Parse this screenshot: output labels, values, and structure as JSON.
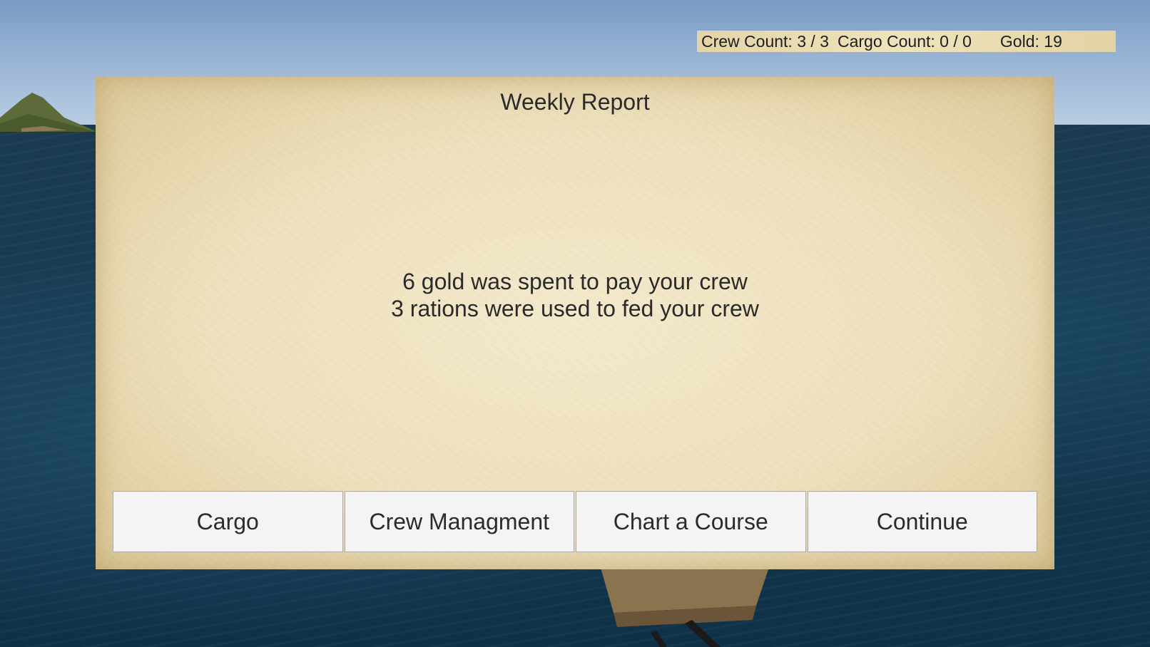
{
  "hud": {
    "crew_count": "Crew Count: 3 / 3",
    "cargo_count": "Cargo Count: 0 / 0",
    "gold": "Gold: 19"
  },
  "dialog": {
    "title": "Weekly Report",
    "lines": [
      "6 gold was spent to pay your crew",
      "3 rations were used to fed your crew"
    ]
  },
  "buttons": {
    "cargo": "Cargo",
    "crew_management": "Crew Managment",
    "chart_course": "Chart a Course",
    "continue": "Continue"
  },
  "colors": {
    "sky": "#a9c1dc",
    "sea": "#173b52",
    "parchment": "#ede0bc",
    "button_bg": "#f4f4f4"
  }
}
